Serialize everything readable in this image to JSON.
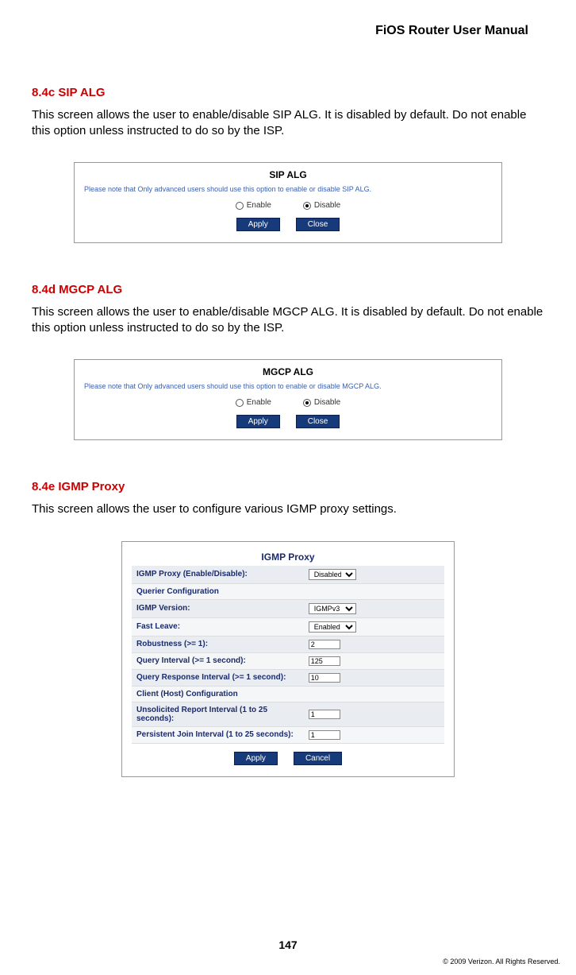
{
  "header": {
    "title": "FiOS Router User Manual"
  },
  "sections": {
    "sip": {
      "heading": "8.4c  SIP ALG",
      "body": "This screen allows the user to enable/disable SIP ALG. It is disabled by default. Do not enable this option unless instructed to do so by the ISP.",
      "panel_title": "SIP ALG",
      "note": "Please note that Only advanced users should use this option to enable or disable SIP ALG.",
      "enable": "Enable",
      "disable": "Disable",
      "apply": "Apply",
      "close": "Close"
    },
    "mgcp": {
      "heading": "8.4d  MGCP ALG",
      "body": "This screen allows the user to enable/disable MGCP ALG. It is disabled by default. Do not enable this option unless instructed to do so by the ISP.",
      "panel_title": "MGCP ALG",
      "note": "Please note that Only advanced users should use this option to enable or disable MGCP ALG.",
      "enable": "Enable",
      "disable": "Disable",
      "apply": "Apply",
      "close": "Close"
    },
    "igmp": {
      "heading": "8.4e  IGMP Proxy",
      "body": "This screen allows the user to configure various IGMP proxy settings.",
      "panel_title": "IGMP Proxy",
      "rows": {
        "proxy_label": "IGMP Proxy (Enable/Disable):",
        "proxy_value": "Disabled",
        "querier_header": "Querier Configuration",
        "version_label": "IGMP Version:",
        "version_value": "IGMPv3",
        "fastleave_label": "Fast Leave:",
        "fastleave_value": "Enabled",
        "robust_label": "Robustness (>= 1):",
        "robust_value": "2",
        "qint_label": "Query Interval (>= 1 second):",
        "qint_value": "125",
        "qresp_label": "Query Response Interval (>= 1 second):",
        "qresp_value": "10",
        "client_header": "Client (Host) Configuration",
        "unsol_label": "Unsolicited Report Interval (1 to 25 seconds):",
        "unsol_value": "1",
        "persist_label": "Persistent Join Interval (1 to 25 seconds):",
        "persist_value": "1"
      },
      "apply": "Apply",
      "cancel": "Cancel"
    }
  },
  "footer": {
    "page": "147",
    "copyright": "© 2009 Verizon. All Rights Reserved."
  }
}
